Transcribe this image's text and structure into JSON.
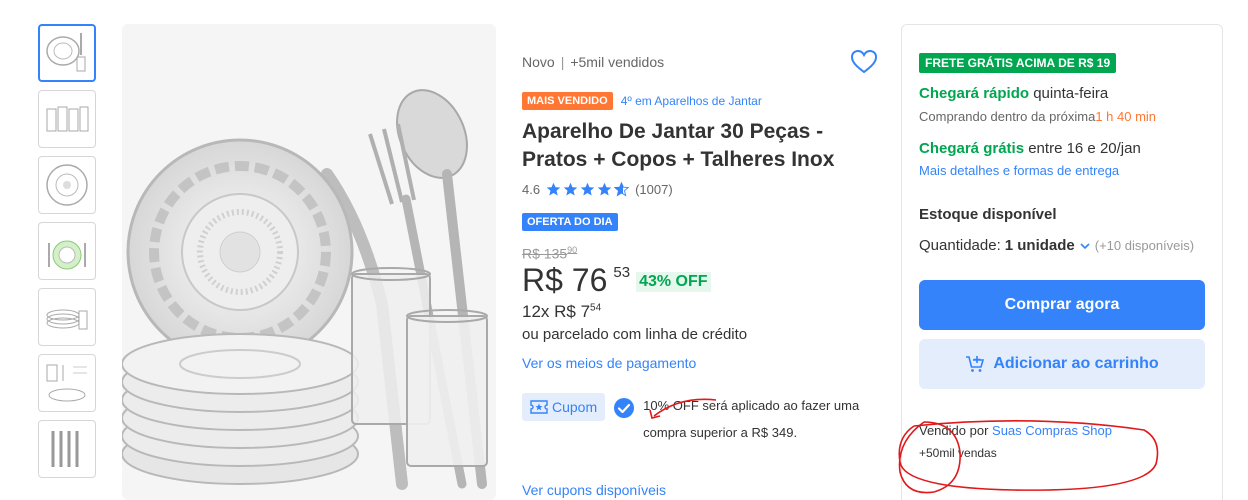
{
  "gallery": {
    "thumbnails": [
      "plates-set-icon",
      "glasses-icon",
      "plate-top-icon",
      "table-set-icon",
      "plates-stack-icon",
      "dimensions-icon",
      "cutlery-icon"
    ]
  },
  "product": {
    "condition": "Novo",
    "separator": "|",
    "sold": "+5mil vendidos",
    "best_seller_badge": "MAIS VENDIDO",
    "category_rank": "4º em Aparelhos de Jantar",
    "title": "Aparelho De Jantar 30 Peças - Pratos + Copos + Talheres Inox",
    "rating_value": "4.6",
    "rating_stars": 4.6,
    "reviews": "(1007)",
    "deal_badge": "OFERTA DO DIA",
    "old_price": "R$ 135",
    "old_price_cents": "90",
    "price": "R$ 76",
    "price_cents": "53",
    "discount": "43% OFF",
    "installments": "12x R$ 7",
    "installments_cents": "54",
    "credit": "ou parcelado com linha de crédito",
    "payment_link": "Ver os meios de pagamento",
    "coupon_label": "Cupom",
    "coupon_text": "10% OFF será aplicado ao fazer uma compra superior a R$ 349.",
    "coupons_link": "Ver cupons disponíveis"
  },
  "sidebar": {
    "free_shipping_badge": "FRETE GRÁTIS ACIMA DE R$ 19",
    "fast_arrival": "Chegará rápido",
    "fast_arrival_day": "quinta-feira",
    "buying_within": "Comprando dentro da próxima",
    "countdown": "1 h 40 min",
    "free_arrival": "Chegará grátis",
    "free_arrival_dates": "entre 16 e 20/jan",
    "delivery_link": "Mais detalhes e formas de entrega",
    "stock": "Estoque disponível",
    "quantity_label": "Quantidade:",
    "quantity_value": "1 unidade",
    "quantity_available": "(+10 disponíveis)",
    "buy_now": "Comprar agora",
    "add_to_cart": "Adicionar ao carrinho",
    "sold_by": "Vendido por",
    "seller_name": "Suas Compras Shop",
    "seller_sales": "+50mil vendas"
  },
  "colors": {
    "accent": "#3483fa",
    "green": "#00a650",
    "orange": "#ff7733",
    "annotation": "#e0191b"
  }
}
